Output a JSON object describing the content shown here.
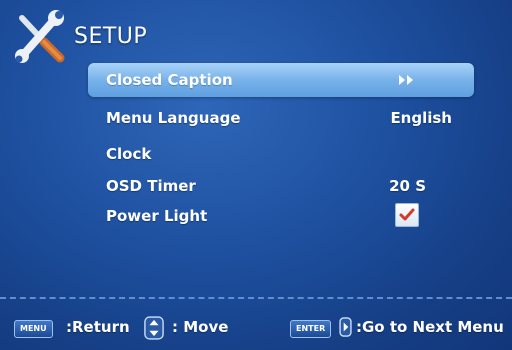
{
  "header": {
    "title": "SETUP",
    "icon": "tools-icon"
  },
  "menu": {
    "items": [
      {
        "label": "Closed Caption",
        "value": "",
        "control": "submenu-arrow",
        "selected": true
      },
      {
        "label": "Menu Language",
        "value": "English"
      },
      {
        "label": "Clock",
        "value": ""
      },
      {
        "label": "OSD Timer",
        "value": "20 S"
      },
      {
        "label": "Power Light",
        "value": "",
        "control": "checkbox",
        "checked": true
      }
    ]
  },
  "footer": {
    "menu_key": "MENU",
    "return_label": ":Return",
    "move_label": ": Move",
    "enter_key": "ENTER",
    "goto_label": ":Go to Next Menu"
  },
  "colors": {
    "background": "#1d4f9e",
    "highlight": "#78b2ea",
    "text": "#ffffff",
    "check": "#d23a2a"
  }
}
